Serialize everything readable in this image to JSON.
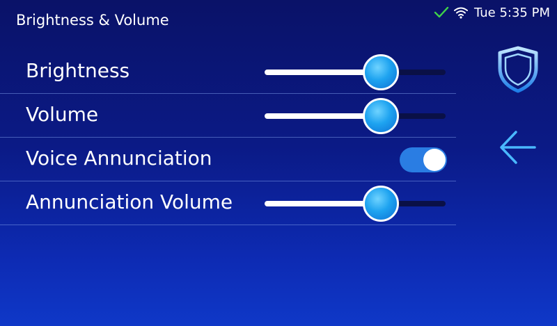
{
  "header": {
    "title": "Brightness & Volume"
  },
  "status_bar": {
    "check_icon": "check-icon",
    "wifi_icon": "wifi-icon",
    "time": "Tue 5:35 PM",
    "check_color": "#3fd14a"
  },
  "settings": [
    {
      "label": "Brightness",
      "control": "slider",
      "level_percent": 64
    },
    {
      "label": "Volume",
      "control": "slider",
      "level_percent": 64
    },
    {
      "label": "Voice Annunciation",
      "control": "toggle",
      "on": true
    },
    {
      "label": "Annunciation Volume",
      "control": "slider",
      "level_percent": 64
    }
  ],
  "side_panel": {
    "shield_icon": "shield-icon",
    "back_icon": "back-arrow-icon"
  },
  "colors": {
    "background_top": "#0a1268",
    "background_bottom": "#0f38c8",
    "accent": "#1ea3f0",
    "toggle_on": "#2a7de3"
  }
}
